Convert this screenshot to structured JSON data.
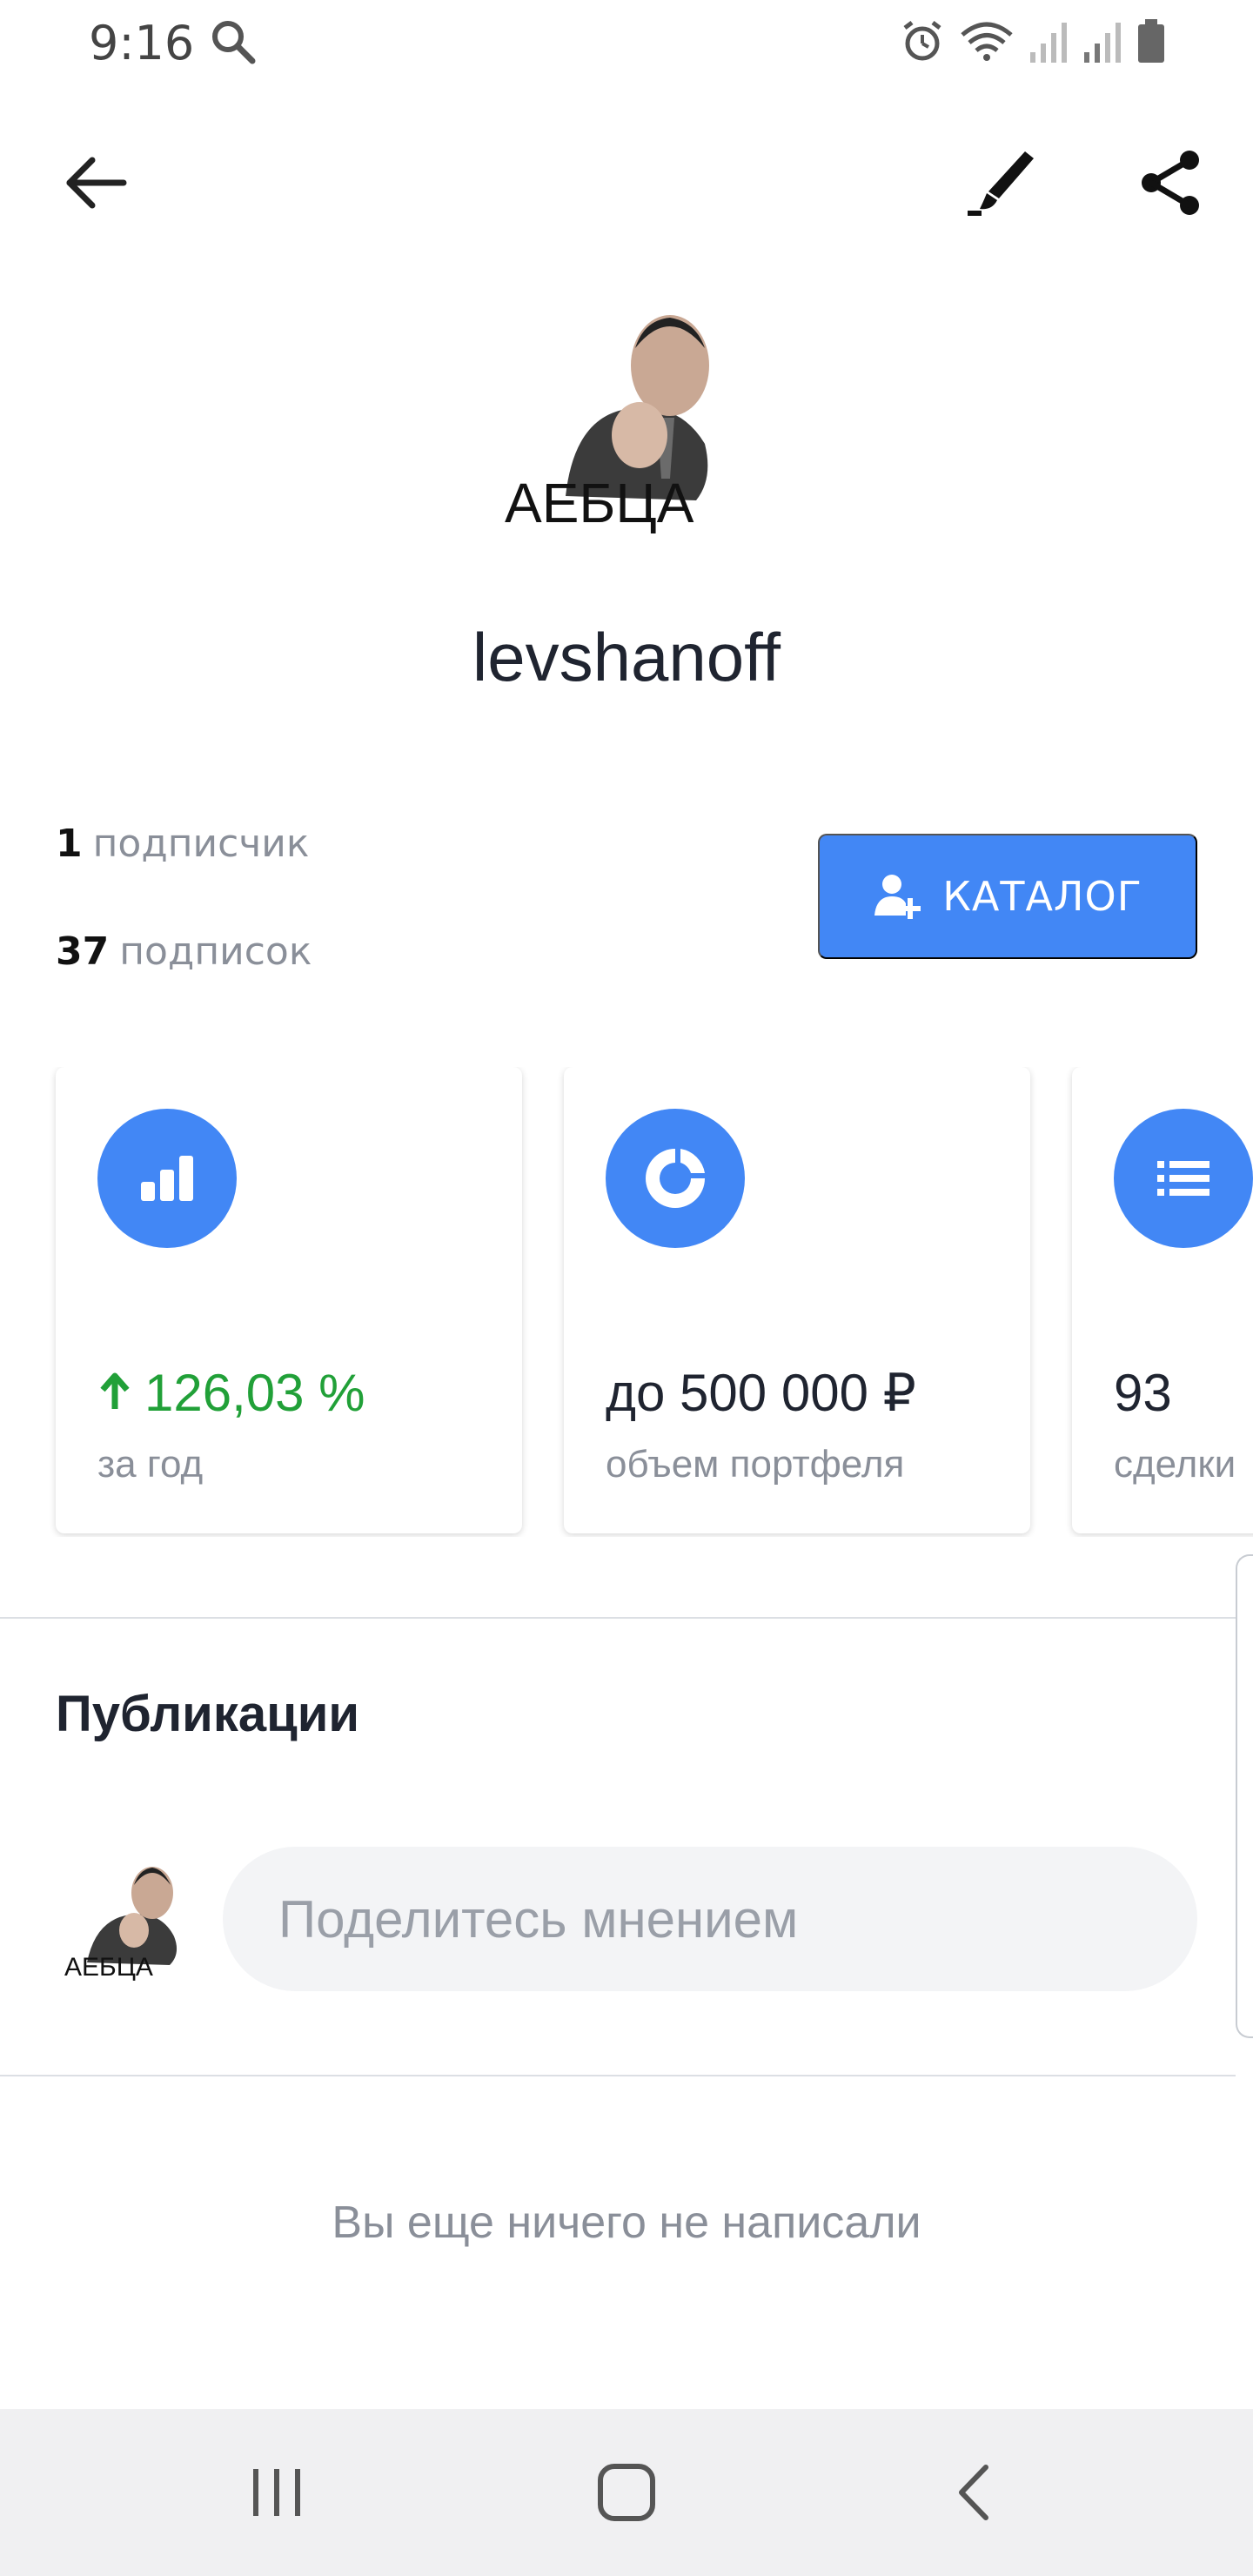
{
  "status_bar": {
    "time": "9:16"
  },
  "profile": {
    "username": "levshanoff",
    "avatar_caption": "АЕБЦА",
    "followers_count": "1",
    "followers_label": "подписчик",
    "following_count": "37",
    "following_label": "подписок",
    "catalog_button": "КАТАЛОГ"
  },
  "cards": [
    {
      "icon": "bar-chart-icon",
      "value": "126,03 %",
      "label": "за год",
      "trend": "up",
      "value_color": "#21a038"
    },
    {
      "icon": "donut-chart-icon",
      "value": "до 500 000 ₽",
      "label": "объем портфеля"
    },
    {
      "icon": "list-icon",
      "value": "93",
      "label": "сделки"
    }
  ],
  "publications": {
    "title": "Публикации",
    "input_placeholder": "Поделитесь мнением",
    "empty_text": "Вы еще ничего не написали"
  },
  "colors": {
    "accent": "#4287f5",
    "positive": "#21a038",
    "muted_text": "#8a8f99"
  }
}
